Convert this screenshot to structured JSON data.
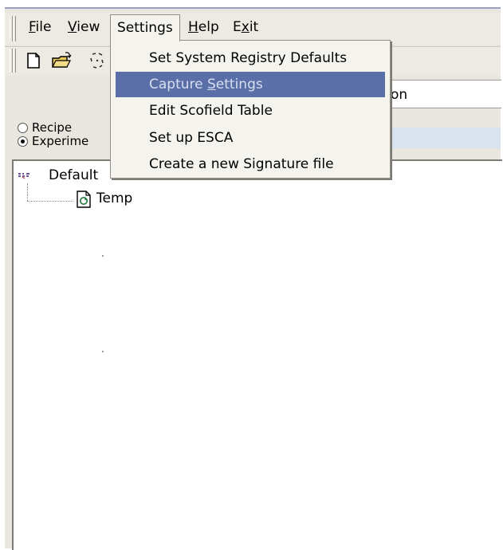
{
  "menubar": {
    "file": "File",
    "view": "View",
    "settings": "Settings",
    "help": "Help",
    "exit": "Exit"
  },
  "settings_menu": {
    "items": [
      {
        "label": "Set System Registry Defaults",
        "highlighted": false
      },
      {
        "label": "Capture Settings",
        "highlighted": true
      },
      {
        "label": "Edit Scofield Table",
        "highlighted": false
      },
      {
        "label": "Set up ESCA",
        "highlighted": false
      },
      {
        "label": "Create a new Signature file",
        "highlighted": false
      }
    ]
  },
  "field": {
    "visible_text": "on"
  },
  "mode": {
    "recipe_label": "Recipe",
    "experiment_label": "Experime",
    "selected": "experiment"
  },
  "tree": {
    "root_label": "Default",
    "child_label": "Temp"
  },
  "icons": {
    "toolbar": [
      "new-file-icon",
      "open-folder-icon",
      "select-icon"
    ],
    "tree": [
      "default-node-icon",
      "recipe-file-icon"
    ]
  },
  "colors": {
    "highlight": "#5a6fa8",
    "window_bg": "#e8e6df"
  }
}
